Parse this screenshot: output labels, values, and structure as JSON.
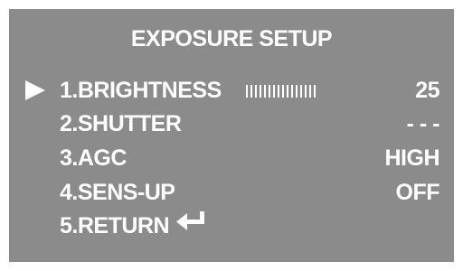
{
  "menu": {
    "title": "EXPOSURE SETUP",
    "selected_index": 0,
    "items": [
      {
        "label": "1.BRIGHTNESS",
        "value": "25",
        "level_percent": 50
      },
      {
        "label": "2.SHUTTER",
        "value": "- - -"
      },
      {
        "label": "3.AGC",
        "value": "HIGH"
      },
      {
        "label": "4.SENS-UP",
        "value": "OFF"
      },
      {
        "label": "5.RETURN",
        "icon": "return-arrow-icon"
      }
    ]
  },
  "colors": {
    "background": "#8b8b8b",
    "text": "#ffffff"
  }
}
